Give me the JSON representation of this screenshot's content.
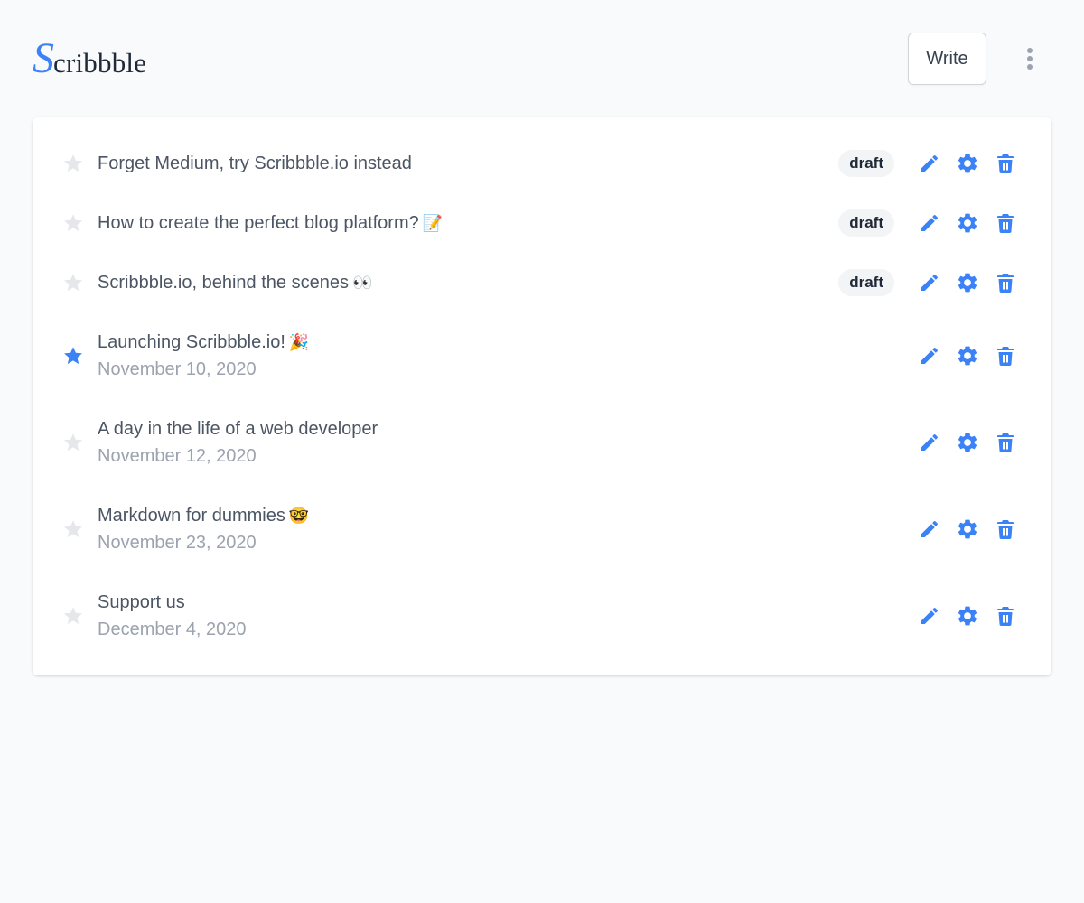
{
  "brand": {
    "initial": "S",
    "rest": "cribbble",
    "accent_color": "#3b82f6"
  },
  "header": {
    "write_label": "Write",
    "more_icon": "more-vertical-icon"
  },
  "colors": {
    "icon_blue": "#3b82f6",
    "star_inactive": "#e5e7eb",
    "badge_bg": "#f3f4f6"
  },
  "posts": [
    {
      "title": "Forget Medium, try Scribbble.io instead",
      "emoji": "",
      "date": "",
      "status": "draft",
      "starred": false
    },
    {
      "title": "How to create the perfect blog platform?",
      "emoji": "📝",
      "date": "",
      "status": "draft",
      "starred": false
    },
    {
      "title": "Scribbble.io, behind the scenes",
      "emoji": "👀",
      "date": "",
      "status": "draft",
      "starred": false
    },
    {
      "title": "Launching Scribbble.io!",
      "emoji": "🎉",
      "date": "November 10, 2020",
      "status": "",
      "starred": true
    },
    {
      "title": "A day in the life of a web developer",
      "emoji": "",
      "date": "November 12, 2020",
      "status": "",
      "starred": false
    },
    {
      "title": "Markdown for dummies",
      "emoji": "🤓",
      "date": "November 23, 2020",
      "status": "",
      "starred": false
    },
    {
      "title": "Support us",
      "emoji": "",
      "date": "December 4, 2020",
      "status": "",
      "starred": false
    }
  ],
  "row_icons": {
    "star": "star-icon",
    "edit": "pencil-icon",
    "settings": "gear-icon",
    "delete": "trash-icon"
  }
}
